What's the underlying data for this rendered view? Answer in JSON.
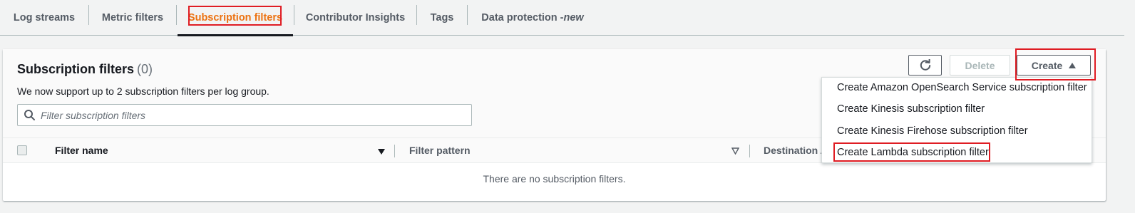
{
  "tabs": {
    "log_streams": "Log streams",
    "metric_filters": "Metric filters",
    "subscription_filters": "Subscription filters",
    "contributor_insights": "Contributor Insights",
    "tags": "Tags",
    "data_protection": "Data protection - ",
    "data_protection_badge": "new"
  },
  "panel": {
    "title": "Subscription filters",
    "count": "(0)",
    "description": "We now support up to 2 subscription filters per log group.",
    "search_placeholder": "Filter subscription filters",
    "refresh_icon": "refresh-icon",
    "delete_label": "Delete",
    "create_label": "Create"
  },
  "table": {
    "columns": [
      "Filter name",
      "Filter pattern",
      "Destination A"
    ],
    "empty_text": "There are no subscription filters."
  },
  "create_menu": {
    "items": [
      "Create Amazon OpenSearch Service subscription filter",
      "Create Kinesis subscription filter",
      "Create Kinesis Firehose subscription filter",
      "Create Lambda subscription filter"
    ]
  },
  "colors": {
    "active_tab": "#ec7211",
    "highlight_box": "#df1c23",
    "text": "#16191f",
    "muted_text": "#545b64"
  }
}
